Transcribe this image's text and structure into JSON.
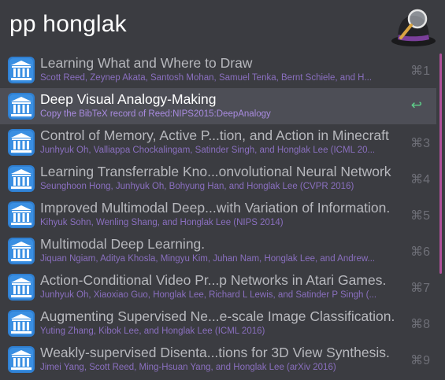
{
  "search": {
    "query": "pp honglak"
  },
  "colors": {
    "background": "#3b3c41",
    "selected_row": "#4d4e56",
    "subtitle": "#8a6fbf",
    "icon_blue": "#2f7fd1",
    "enter_green": "#5fd08a",
    "scrollbar": "#b0509a"
  },
  "app_icon": "alfred-hat-magnifier-icon",
  "results": [
    {
      "title": "Learning What and Where to Draw",
      "subtitle": "Scott Reed, Zeynep Akata, Santosh Mohan, Samuel Tenka, Bernt Schiele, and H...",
      "shortcut": "⌘1",
      "icon": "library-icon"
    },
    {
      "title": "Deep Visual Analogy-Making",
      "subtitle": "Copy the BibTeX record of Reed:NIPS2015:DeepAnalogy",
      "shortcut": "↩",
      "icon": "library-icon"
    },
    {
      "title": "Control of Memory, Active P...tion, and Action in Minecraft",
      "subtitle": "Junhyuk Oh, Valliappa Chockalingam, Satinder Singh, and Honglak Lee (ICML 20...",
      "shortcut": "⌘3",
      "icon": "library-icon"
    },
    {
      "title": "Learning Transferrable Kno...onvolutional Neural Network",
      "subtitle": "Seunghoon Hong, Junhyuk Oh, Bohyung Han, and Honglak Lee (CVPR 2016)",
      "shortcut": "⌘4",
      "icon": "library-icon"
    },
    {
      "title": "Improved Multimodal Deep...with Variation of Information.",
      "subtitle": "Kihyuk Sohn, Wenling Shang, and Honglak Lee (NIPS 2014)",
      "shortcut": "⌘5",
      "icon": "library-icon"
    },
    {
      "title": "Multimodal Deep Learning.",
      "subtitle": "Jiquan Ngiam, Aditya Khosla, Mingyu Kim, Juhan Nam, Honglak Lee, and Andrew...",
      "shortcut": "⌘6",
      "icon": "library-icon"
    },
    {
      "title": "Action-Conditional Video Pr...p Networks in Atari Games.",
      "subtitle": "Junhyuk Oh, Xiaoxiao Guo, Honglak Lee, Richard L Lewis, and Satinder P Singh (...",
      "shortcut": "⌘7",
      "icon": "library-icon"
    },
    {
      "title": "Augmenting Supervised Ne...e-scale Image Classification.",
      "subtitle": "Yuting Zhang, Kibok Lee, and Honglak Lee (ICML 2016)",
      "shortcut": "⌘8",
      "icon": "library-icon"
    },
    {
      "title": "Weakly-supervised Disenta...tions for 3D View Synthesis.",
      "subtitle": "Jimei Yang, Scott Reed, Ming-Hsuan Yang, and Honglak Lee (arXiv 2016)",
      "shortcut": "⌘9",
      "icon": "library-icon"
    }
  ]
}
